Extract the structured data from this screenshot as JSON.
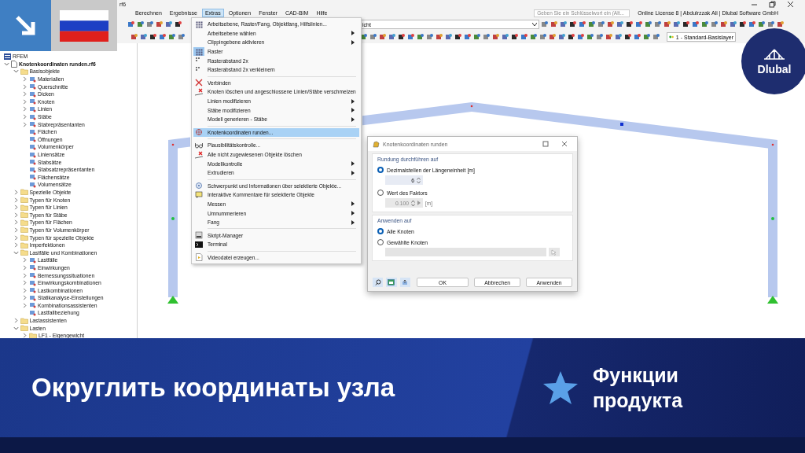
{
  "window": {
    "title": "rf6"
  },
  "menu_bar": [
    {
      "label": "Berechnen",
      "selected": false
    },
    {
      "label": "Ergebnisse",
      "selected": false
    },
    {
      "label": "Extras",
      "selected": true
    },
    {
      "label": "Optionen",
      "selected": false
    },
    {
      "label": "Fenster",
      "selected": false
    },
    {
      "label": "CAD-BIM",
      "selected": false
    },
    {
      "label": "Hilfe",
      "selected": false
    }
  ],
  "search": {
    "placeholder": "Geben Sie ein Schlüsselwort ein (Alt..."
  },
  "license": "Online License 8 | Abdulrzzak Ali | Dlubal Software GmbH",
  "toolbar": {
    "view_dropdown": "icht",
    "layer_dropdown": "1 - Standard-Basislayer"
  },
  "tree": [
    {
      "label": "RFEM",
      "kind": "app"
    },
    {
      "label": "Knotenkoordinaten runden.rf6",
      "kind": "file",
      "expanded": true,
      "children": [
        {
          "label": "Basisobjekte",
          "kind": "folder",
          "expanded": true,
          "children": [
            {
              "label": "Materialien",
              "kind": "object",
              "expanded": false
            },
            {
              "label": "Querschnitte",
              "kind": "object",
              "expanded": false
            },
            {
              "label": "Dicken",
              "kind": "object",
              "expanded": false
            },
            {
              "label": "Knoten",
              "kind": "object",
              "expanded": false
            },
            {
              "label": "Linien",
              "kind": "object",
              "expanded": false
            },
            {
              "label": "Stäbe",
              "kind": "object",
              "expanded": false
            },
            {
              "label": "Stabrepräsentanten",
              "kind": "object",
              "expanded": false
            },
            {
              "label": "Flächen",
              "kind": "object"
            },
            {
              "label": "Öffnungen",
              "kind": "object"
            },
            {
              "label": "Volumenkörper",
              "kind": "object"
            },
            {
              "label": "Liniensätze",
              "kind": "object"
            },
            {
              "label": "Stabsätze",
              "kind": "object"
            },
            {
              "label": "Stabsatzrepräsentanten",
              "kind": "object"
            },
            {
              "label": "Flächensätze",
              "kind": "object"
            },
            {
              "label": "Volumensätze",
              "kind": "object"
            }
          ]
        },
        {
          "label": "Spezielle Objekte",
          "kind": "folder",
          "expanded": false
        },
        {
          "label": "Typen für Knoten",
          "kind": "folder",
          "expanded": false
        },
        {
          "label": "Typen für Linien",
          "kind": "folder",
          "expanded": false
        },
        {
          "label": "Typen für Stäbe",
          "kind": "folder",
          "expanded": false
        },
        {
          "label": "Typen für Flächen",
          "kind": "folder",
          "expanded": false
        },
        {
          "label": "Typen für Volumenkörper",
          "kind": "folder",
          "expanded": false
        },
        {
          "label": "Typen für spezielle Objekte",
          "kind": "folder",
          "expanded": false
        },
        {
          "label": "Imperfektionen",
          "kind": "folder",
          "expanded": false
        },
        {
          "label": "Lastfälle und Kombinationen",
          "kind": "folder",
          "expanded": true,
          "children": [
            {
              "label": "Lastfälle",
              "kind": "object",
              "expanded": false
            },
            {
              "label": "Einwirkungen",
              "kind": "object",
              "expanded": false
            },
            {
              "label": "Bemessungssituationen",
              "kind": "object",
              "expanded": false
            },
            {
              "label": "Einwirkungskombinationen",
              "kind": "object",
              "expanded": false
            },
            {
              "label": "Lastkombinationen",
              "kind": "object",
              "expanded": false
            },
            {
              "label": "Statikanalyse-Einstellungen",
              "kind": "object",
              "expanded": false
            },
            {
              "label": "Kombinationsassistenten",
              "kind": "object",
              "expanded": false
            },
            {
              "label": "Lastfallbeziehung",
              "kind": "object"
            }
          ]
        },
        {
          "label": "Lastassistenten",
          "kind": "folder",
          "expanded": false
        },
        {
          "label": "Lasten",
          "kind": "folder",
          "expanded": true,
          "children": [
            {
              "label": "LF1 - Eigengewicht",
              "kind": "folder",
              "expanded": false
            }
          ]
        }
      ]
    }
  ],
  "extras_menu": [
    {
      "items": [
        {
          "label": "Arbeitsebene, Raster/Fang, Objektfang, Hilfslinien...",
          "kind": "grid",
          "submenu": false,
          "checked": false,
          "selected": false
        },
        {
          "label": "Arbeitsebene wählen",
          "kind": "text",
          "submenu": true,
          "checked": false,
          "selected": false
        },
        {
          "label": "Clippingebene aktivieren",
          "kind": "text",
          "submenu": true,
          "checked": false,
          "selected": false
        },
        {
          "label": "Raster",
          "kind": "grid",
          "submenu": false,
          "checked": true,
          "selected": false
        },
        {
          "label": "Rasterabstand 2x",
          "kind": "dots",
          "submenu": false,
          "checked": false,
          "selected": false
        },
        {
          "label": "Rasterabstand 2x verkleinern",
          "kind": "dots",
          "submenu": false,
          "checked": false,
          "selected": false
        }
      ]
    },
    {
      "items": [
        {
          "label": "Verbinden",
          "kind": "cross",
          "submenu": false,
          "checked": false,
          "selected": false
        },
        {
          "label": "Knoten löschen und angeschlossene Linien/Stäbe verschmelzen",
          "kind": "delete",
          "submenu": false,
          "checked": false,
          "selected": false
        },
        {
          "label": "Linien modifizieren",
          "kind": "text",
          "submenu": true,
          "checked": false,
          "selected": false
        },
        {
          "label": "Stäbe modifizieren",
          "kind": "text",
          "submenu": true,
          "checked": false,
          "selected": false
        },
        {
          "label": "Modell generieren - Stäbe",
          "kind": "text",
          "submenu": true,
          "checked": false,
          "selected": false
        }
      ]
    },
    {
      "items": [
        {
          "label": "Knotenkoordinaten runden...",
          "kind": "target",
          "submenu": false,
          "checked": false,
          "selected": true
        }
      ]
    },
    {
      "items": [
        {
          "label": "Plausibilitätskontrolle...",
          "kind": "glasses",
          "submenu": false,
          "checked": false,
          "selected": false
        },
        {
          "label": "Alle nicht zugewiesenen Objekte löschen",
          "kind": "delete",
          "submenu": false,
          "checked": false,
          "selected": false
        },
        {
          "label": "Modellkontrolle",
          "kind": "text",
          "submenu": true,
          "checked": false,
          "selected": false
        },
        {
          "label": "Extrudieren",
          "kind": "text",
          "submenu": true,
          "checked": false,
          "selected": false
        }
      ]
    },
    {
      "items": [
        {
          "label": "Schwerpunkt und Informationen über selektierte Objekte...",
          "kind": "info",
          "submenu": false,
          "checked": false,
          "selected": false
        },
        {
          "label": "Interaktive Kommentare für selektierte Objekte",
          "kind": "comment",
          "submenu": false,
          "checked": false,
          "selected": false
        },
        {
          "label": "Messen",
          "kind": "text",
          "submenu": true,
          "checked": false,
          "selected": false
        },
        {
          "label": "Umnummerieren",
          "kind": "text",
          "submenu": true,
          "checked": false,
          "selected": false
        },
        {
          "label": "Fang",
          "kind": "text",
          "submenu": true,
          "checked": false,
          "selected": false
        }
      ]
    },
    {
      "items": [
        {
          "label": "Skript-Manager",
          "kind": "script",
          "submenu": false,
          "checked": false,
          "selected": false
        },
        {
          "label": "Terminal",
          "kind": "terminal",
          "submenu": false,
          "checked": false,
          "selected": false
        }
      ]
    },
    {
      "items": [
        {
          "label": "Videodatei erzeugen...",
          "kind": "video",
          "submenu": false,
          "checked": false,
          "selected": false
        }
      ]
    }
  ],
  "dialog": {
    "title": "Knotenkoordinaten runden",
    "sections": [
      {
        "heading": "Rundung durchführen auf",
        "options": [
          {
            "label": "Dezimalstellen der Längeneinheit [m]",
            "selected": true,
            "input": {
              "kind": "spin",
              "value": "6",
              "disabled": false
            }
          },
          {
            "label": "Wert des Faktors",
            "selected": false,
            "input": {
              "kind": "spin",
              "value": "0.100",
              "unit": "[m]",
              "disabled": true
            }
          }
        ]
      },
      {
        "heading": "Anwenden auf",
        "options": [
          {
            "label": "Alle Knoten",
            "selected": true
          },
          {
            "label": "Gewählte Knoten",
            "selected": false,
            "input": {
              "kind": "pick",
              "disabled": true
            }
          }
        ]
      }
    ],
    "buttons": [
      "OK",
      "Abbrechen",
      "Anwenden"
    ]
  },
  "logo": "Dlubal",
  "banner": {
    "title": "Округлить координаты узла",
    "tag": "Функции продукта"
  }
}
